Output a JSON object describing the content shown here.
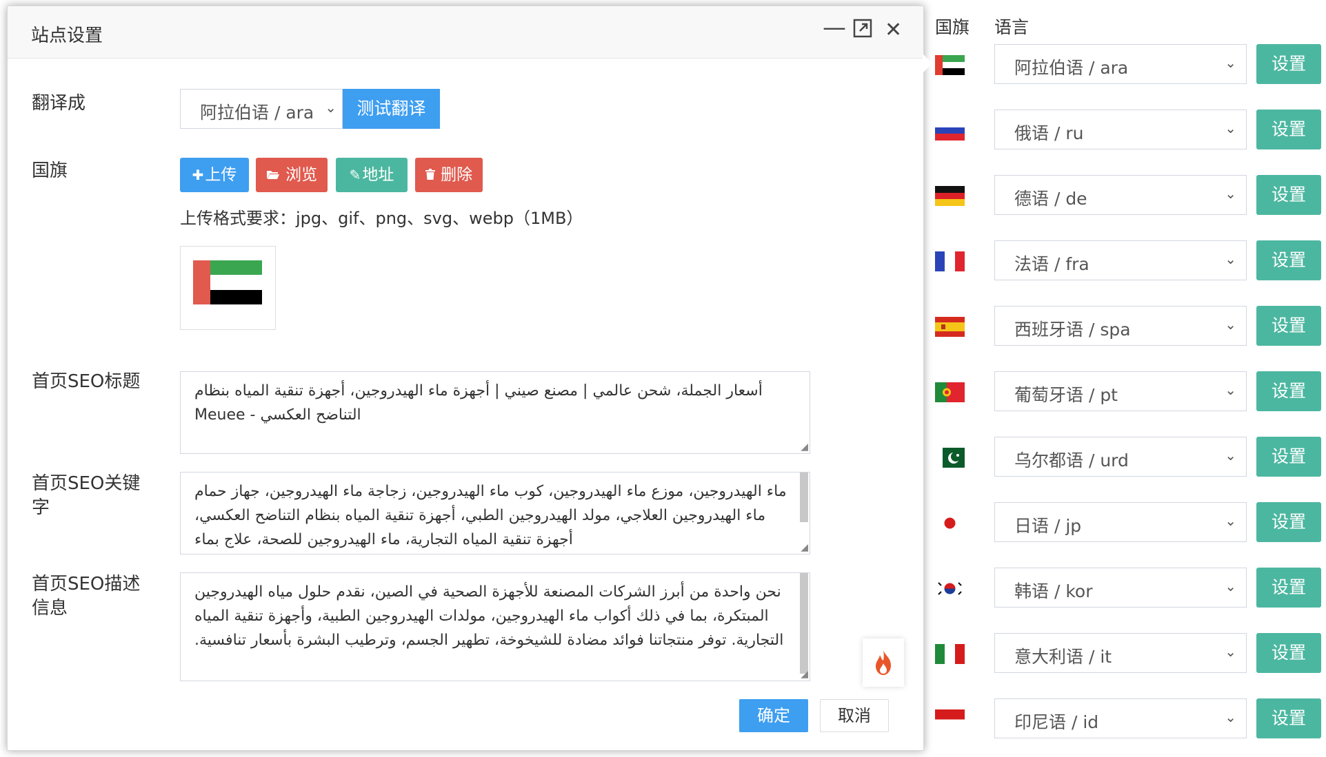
{
  "dialog": {
    "title": "站点设置",
    "controls": {
      "minimize": "—",
      "maximize": "⤢",
      "close": "✕"
    },
    "translate": {
      "label": "翻译成",
      "selected": "阿拉伯语 / ara",
      "test_button": "测试翻译"
    },
    "flag": {
      "label": "国旗",
      "buttons": [
        {
          "icon": "plus-icon",
          "glyph": "✚",
          "label": "上传",
          "color": "#3e9ef0"
        },
        {
          "icon": "folder-open-icon",
          "glyph": "📂",
          "label": "浏览",
          "color": "#e05a4e"
        },
        {
          "icon": "edit-icon",
          "glyph": "✎",
          "label": "地址",
          "color": "#4cb7a0"
        },
        {
          "icon": "trash-icon",
          "glyph": "🗑",
          "label": "删除",
          "color": "#e05a4e"
        }
      ],
      "format_hint": "上传格式要求：jpg、gif、png、svg、webp（1MB）"
    },
    "seo_title": {
      "label": "首页SEO标题",
      "value": "أسعار الجملة، شحن عالمي | مصنع صيني | أجهزة ماء الهيدروجين، أجهزة تنقية المياه بنظام التناضح العكسي - Meuee"
    },
    "seo_keywords": {
      "label": "首页SEO关键字",
      "value": "ماء الهيدروجين، موزع ماء الهيدروجين، كوب ماء الهيدروجين، زجاجة ماء الهيدروجين، جهاز حمام ماء الهيدروجين العلاجي، مولد الهيدروجين الطبي، أجهزة تنقية المياه بنظام التناضح العكسي، أجهزة تنقية المياه التجارية، ماء الهيدروجين للصحة، علاج بماء"
    },
    "seo_description": {
      "label": "首页SEO描述信息",
      "value": "نحن واحدة من أبرز الشركات المصنعة للأجهزة الصحية في الصين، نقدم حلول مياه الهيدروجين المبتكرة، بما في ذلك أكواب ماء الهيدروجين، مولدات الهيدروجين الطبية، وأجهزة تنقية المياه التجارية. توفر منتجاتنا فوائد مضادة للشيخوخة، تطهير الجسم، وترطيب البشرة بأسعار تنافسية."
    },
    "ok_button": "确定",
    "cancel_button": "取消",
    "fire_icon": "fire-icon"
  },
  "language_panel": {
    "flag_header": "国旗",
    "language_header": "语言",
    "set_label": "设置",
    "rows": [
      {
        "flag": "uae",
        "language": "阿拉伯语 / ara"
      },
      {
        "flag": "russia",
        "language": "俄语 / ru"
      },
      {
        "flag": "germany",
        "language": "德语 / de"
      },
      {
        "flag": "france",
        "language": "法语 / fra"
      },
      {
        "flag": "spain",
        "language": "西班牙语 / spa"
      },
      {
        "flag": "portugal",
        "language": "葡萄牙语 / pt"
      },
      {
        "flag": "pakistan",
        "language": "乌尔都语 / urd"
      },
      {
        "flag": "japan",
        "language": "日语 / jp"
      },
      {
        "flag": "korea",
        "language": "韩语 / kor"
      },
      {
        "flag": "italy",
        "language": "意大利语 / it"
      },
      {
        "flag": "indonesia",
        "language": "印尼语 / id"
      }
    ]
  },
  "colors": {
    "primary": "#3e9ef0",
    "teal": "#4cb7a0",
    "danger": "#e05a4e"
  }
}
